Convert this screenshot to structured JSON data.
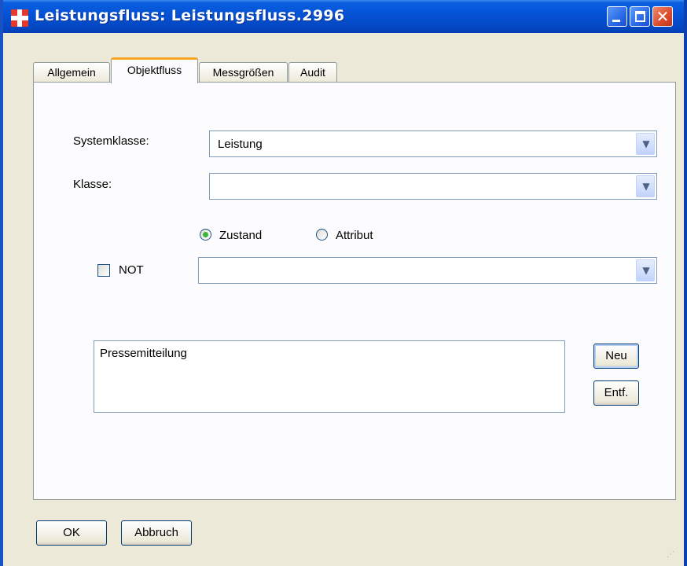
{
  "window": {
    "title": "Leistungsfluss: Leistungsfluss.2996",
    "controls": [
      "minimize-icon",
      "maximize-icon",
      "close-icon"
    ]
  },
  "tabs": [
    {
      "label": "Allgemein",
      "active": false
    },
    {
      "label": "Objektfluss",
      "active": true
    },
    {
      "label": "Messgrößen",
      "active": false
    },
    {
      "label": "Audit",
      "active": false
    }
  ],
  "form": {
    "systemklasse_label": "Systemklasse:",
    "systemklasse_value": "Leistung",
    "klasse_label": "Klasse:",
    "klasse_value": "",
    "radio_zustand_label": "Zustand",
    "radio_zustand_selected": true,
    "radio_attribut_label": "Attribut",
    "radio_attribut_selected": false,
    "not_label": "NOT",
    "not_checked": false,
    "zustand_value": ""
  },
  "list": {
    "items": [
      "Pressemitteilung"
    ]
  },
  "side_buttons": {
    "neu": "Neu",
    "entf": "Entf."
  },
  "footer": {
    "ok": "OK",
    "abbruch": "Abbruch"
  },
  "colors": {
    "titlebar": "#0553d6",
    "active_tab_accent": "#f5a623",
    "radio_dot": "#3ab53a",
    "window_bg": "#ece9d8"
  }
}
